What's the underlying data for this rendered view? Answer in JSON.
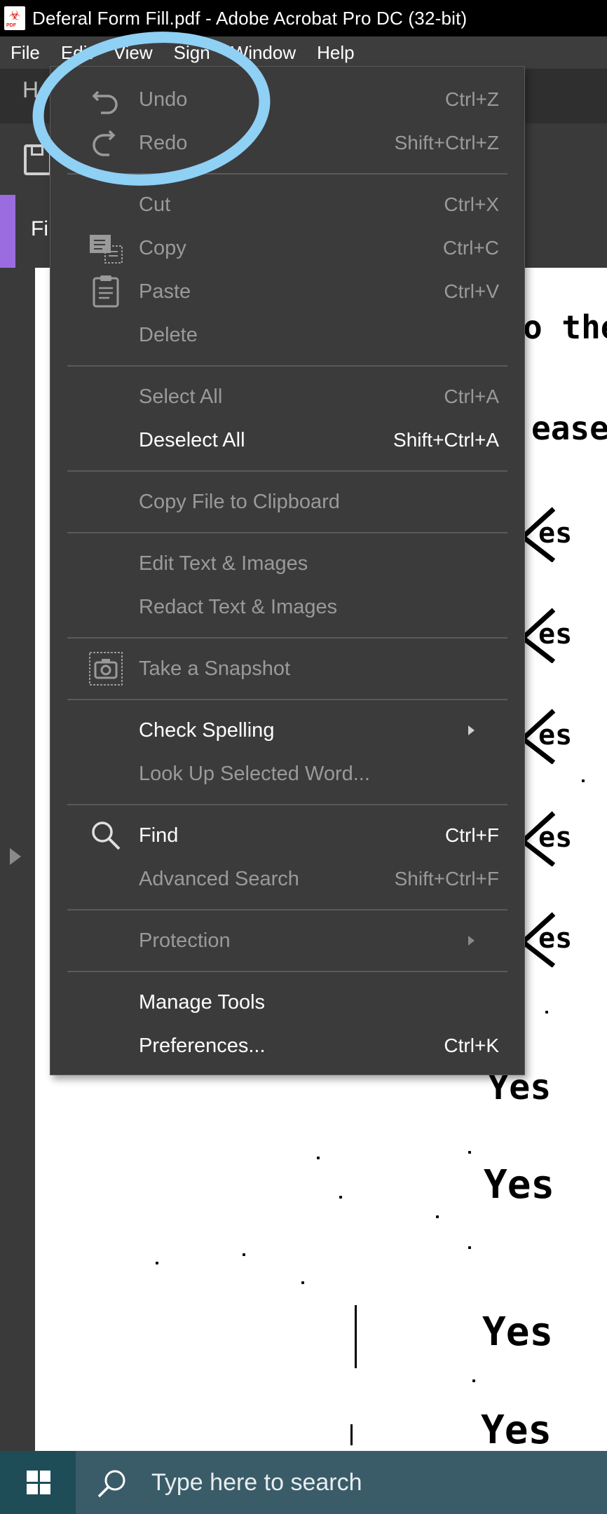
{
  "window": {
    "title": "Deferal Form Fill.pdf - Adobe Acrobat Pro DC (32-bit)",
    "app_icon": "acrobat-pdf-icon",
    "app_icon_tag": "PDF"
  },
  "menubar": {
    "items": [
      {
        "label": "File"
      },
      {
        "label": "Edit"
      },
      {
        "label": "View"
      },
      {
        "label": "Sign"
      },
      {
        "label": "Window"
      },
      {
        "label": "Help"
      }
    ]
  },
  "toolbar": {
    "home_label": "H",
    "save_icon": "save-icon"
  },
  "tab": {
    "label": "Fi",
    "accent_color": "#9b6ce0"
  },
  "edit_menu": {
    "items": [
      {
        "label": "Undo",
        "shortcut": "Ctrl+Z",
        "enabled": false,
        "icon": "undo-icon"
      },
      {
        "label": "Redo",
        "shortcut": "Shift+Ctrl+Z",
        "enabled": false,
        "icon": "redo-icon"
      },
      {
        "label": "Cut",
        "shortcut": "Ctrl+X",
        "enabled": false
      },
      {
        "label": "Copy",
        "shortcut": "Ctrl+C",
        "enabled": false,
        "icon": "copy-icon"
      },
      {
        "label": "Paste",
        "shortcut": "Ctrl+V",
        "enabled": false,
        "icon": "paste-icon"
      },
      {
        "label": "Delete",
        "shortcut": "",
        "enabled": false
      },
      {
        "label": "Select All",
        "shortcut": "Ctrl+A",
        "enabled": false
      },
      {
        "label": "Deselect All",
        "shortcut": "Shift+Ctrl+A",
        "enabled": true
      },
      {
        "label": "Copy File to Clipboard",
        "shortcut": "",
        "enabled": false
      },
      {
        "label": "Edit Text & Images",
        "shortcut": "",
        "enabled": false
      },
      {
        "label": "Redact Text & Images",
        "shortcut": "",
        "enabled": false
      },
      {
        "label": "Take a Snapshot",
        "shortcut": "",
        "enabled": false,
        "icon": "camera-icon"
      },
      {
        "label": "Check Spelling",
        "shortcut": "",
        "enabled": true,
        "submenu": true
      },
      {
        "label": "Look Up Selected Word...",
        "shortcut": "",
        "enabled": false
      },
      {
        "label": "Find",
        "shortcut": "Ctrl+F",
        "enabled": true,
        "icon": "search-icon"
      },
      {
        "label": "Advanced Search",
        "shortcut": "Shift+Ctrl+F",
        "enabled": false
      },
      {
        "label": "Protection",
        "shortcut": "",
        "enabled": false,
        "submenu": true
      },
      {
        "label": "Manage Tools",
        "shortcut": "",
        "enabled": true
      },
      {
        "label": "Preferences...",
        "shortcut": "Ctrl+K",
        "enabled": true
      }
    ]
  },
  "document": {
    "text_fragments": [
      "o the",
      "ease",
      "es",
      "es",
      "es",
      "es",
      "es",
      "Yes",
      "Yes",
      "Yes",
      "Yes"
    ]
  },
  "annotation": {
    "color": "#8fd0f5"
  },
  "taskbar": {
    "start_icon": "windows-logo-icon",
    "search_placeholder": "Type here to search",
    "search_icon": "search-icon"
  }
}
